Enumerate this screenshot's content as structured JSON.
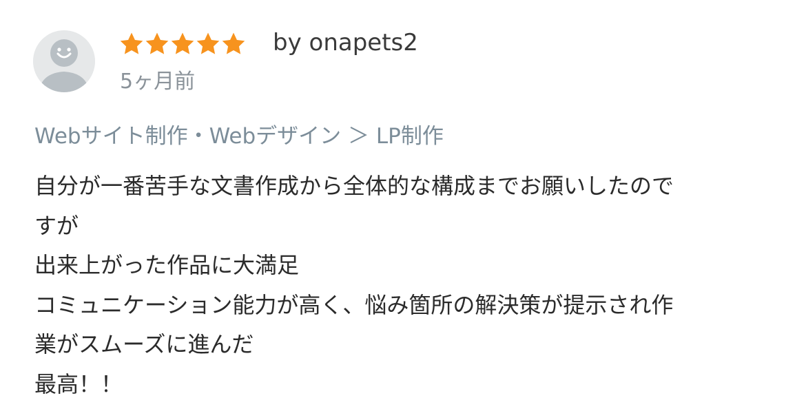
{
  "review": {
    "rating": 5,
    "max_rating": 5,
    "star_color": "#f7931e",
    "avatar_icon": "user-avatar-icon",
    "reviewer": "by onapets2",
    "timestamp": "5ヶ月前",
    "category": "Webサイト制作・Webデザイン ＞ LP制作",
    "body_lines": [
      "自分が一番苦手な文書作成から全体的な構成までお願いしたので",
      "すが",
      "出来上がった作品に大満足",
      "コミュニケーション能力が高く、悩み箇所の解決策が提示され作",
      "業がスムーズに進んだ",
      "最高！！"
    ]
  }
}
